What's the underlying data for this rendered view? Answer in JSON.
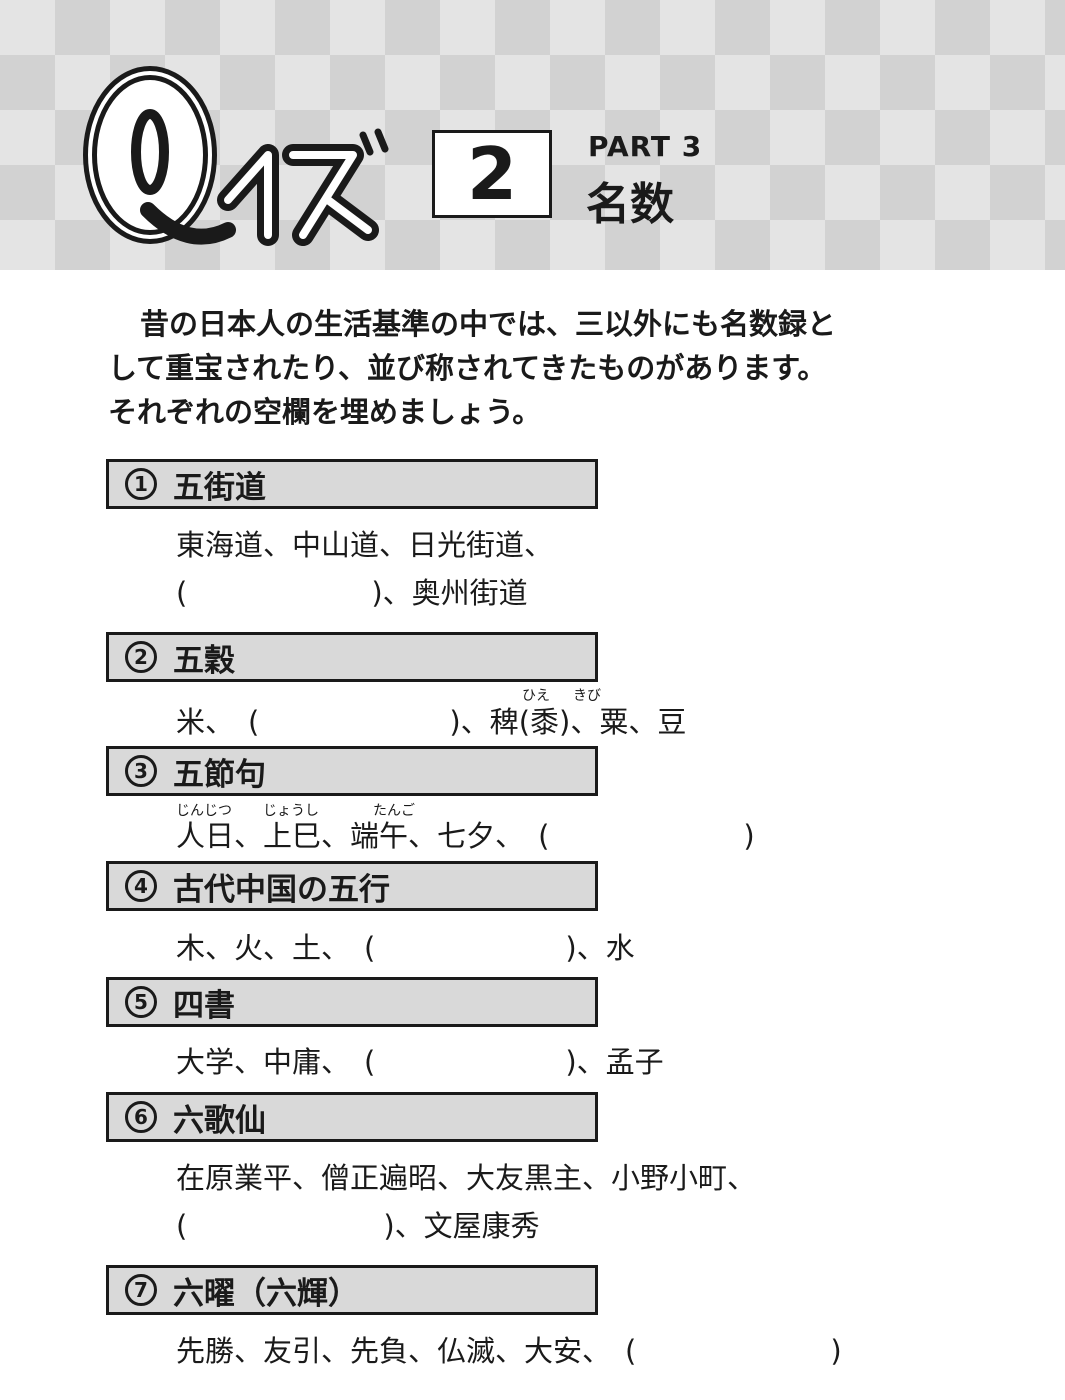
{
  "header": {
    "logo_text": "Qイズ",
    "quiz_number": "2",
    "part_label": "PART 3",
    "part_title": "名数"
  },
  "intro": {
    "line1": "昔の日本人の生活基準の中では、三以外にも名数録と",
    "line2": "して重宝されたり、並び称されてきたものがあります。",
    "line3": "それぞれの空欄を埋めましょう。"
  },
  "sections": [
    {
      "num": "1",
      "title": "五街道",
      "line1": "東海道、中山道、日光街道、",
      "line2_open": "(",
      "line2_close": ")、奥州街道"
    },
    {
      "num": "2",
      "title": "五穀",
      "pre": "米、",
      "open": "(",
      "close": ")、",
      "post1": "稗",
      "paren_open": "(",
      "post2": "黍",
      "paren_close": ")",
      "post3": "、粟、豆",
      "ruby1": "ひえ",
      "ruby2": "きび"
    },
    {
      "num": "3",
      "title": "五節句",
      "w1": "人日",
      "w2": "、上巳",
      "w3": "、端午",
      "w4": "、七夕、",
      "open": "(",
      "close": ")",
      "ruby1": "じんじつ",
      "ruby2": "じょうし",
      "ruby3": "たんご"
    },
    {
      "num": "4",
      "title": "古代中国の五行",
      "pre": "木、火、土、",
      "open": "(",
      "close": ")、水"
    },
    {
      "num": "5",
      "title": "四書",
      "pre": "大学、中庸、",
      "open": "(",
      "close": ")、孟子"
    },
    {
      "num": "6",
      "title": "六歌仙",
      "line1": "在原業平、僧正遍昭、大友黒主、小野小町、",
      "line2_open": "(",
      "line2_close": ")、文屋康秀"
    },
    {
      "num": "7",
      "title": "六曜（六輝）",
      "pre": "先勝、友引、先負、仏滅、大安、",
      "open": "(",
      "close": ")"
    }
  ]
}
